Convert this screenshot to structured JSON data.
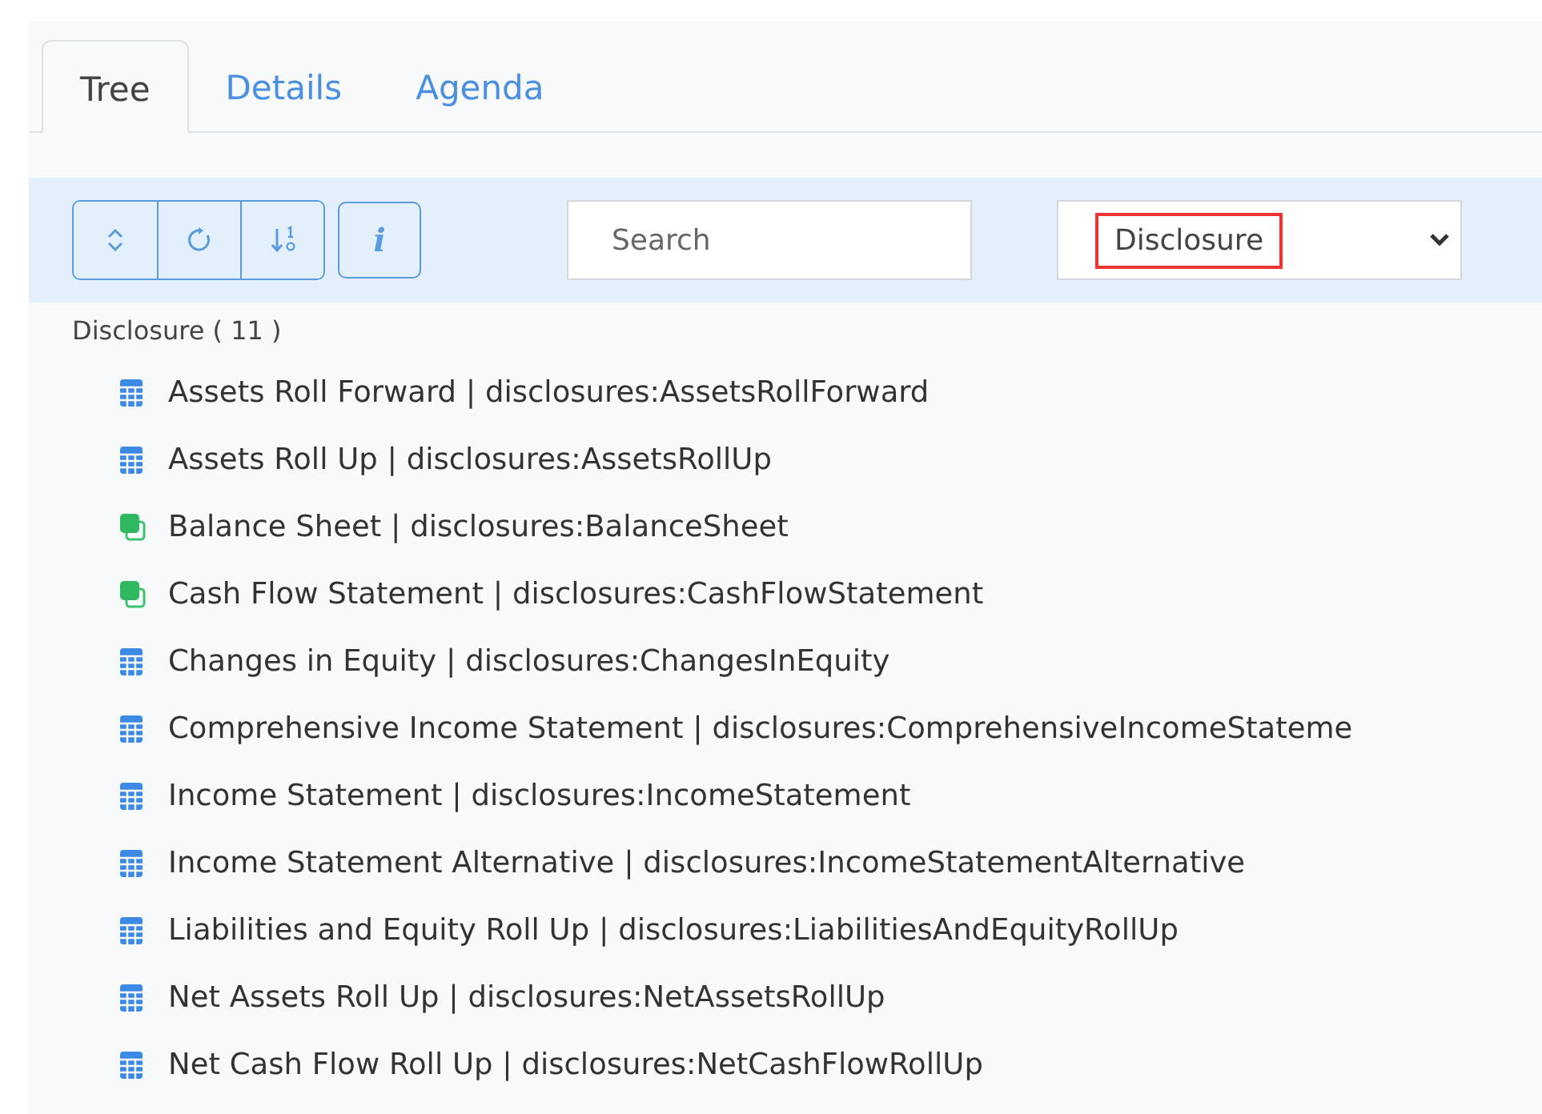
{
  "tabs": [
    {
      "label": "Tree",
      "selected": true
    },
    {
      "label": "Details",
      "selected": false
    },
    {
      "label": "Agenda",
      "selected": false
    }
  ],
  "toolbar": {
    "buttons": [
      {
        "kind": "expand"
      },
      {
        "kind": "refresh"
      },
      {
        "kind": "sort"
      }
    ],
    "info_button": "i",
    "search": {
      "placeholder": "Search"
    },
    "type_select": {
      "value": "Disclosure",
      "highlighted": true
    }
  },
  "tree": {
    "title": "Disclosure ( 11 )",
    "items": [
      {
        "kind": "table",
        "label": "Assets Roll Forward | disclosures:AssetsRollForward"
      },
      {
        "kind": "table",
        "label": "Assets Roll Up | disclosures:AssetsRollUp"
      },
      {
        "kind": "statement",
        "label": "Balance Sheet | disclosures:BalanceSheet"
      },
      {
        "kind": "statement",
        "label": "Cash Flow Statement | disclosures:CashFlowStatement"
      },
      {
        "kind": "table",
        "label": "Changes in Equity | disclosures:ChangesInEquity"
      },
      {
        "kind": "table",
        "label": "Comprehensive Income Statement | disclosures:ComprehensiveIncomeStateme"
      },
      {
        "kind": "table",
        "label": "Income Statement | disclosures:IncomeStatement"
      },
      {
        "kind": "table",
        "label": "Income Statement Alternative | disclosures:IncomeStatementAlternative"
      },
      {
        "kind": "table",
        "label": "Liabilities and Equity Roll Up | disclosures:LiabilitiesAndEquityRollUp"
      },
      {
        "kind": "table",
        "label": "Net Assets Roll Up | disclosures:NetAssetsRollUp"
      },
      {
        "kind": "table",
        "label": "Net Cash Flow Roll Up | disclosures:NetCashFlowRollUp"
      }
    ]
  }
}
